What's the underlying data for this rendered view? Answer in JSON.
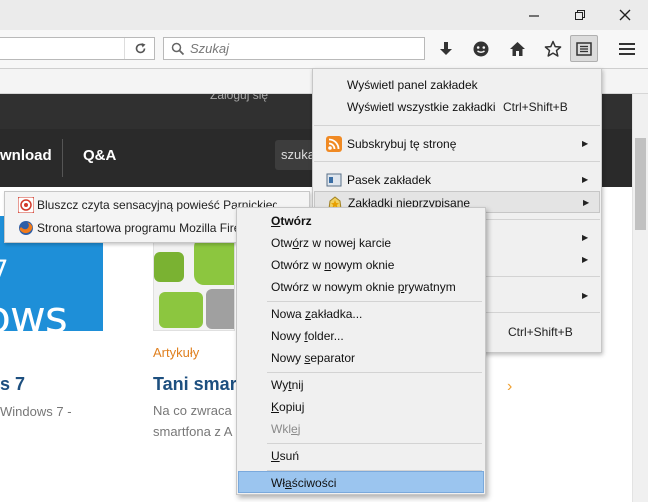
{
  "window": {
    "minimize_glyph": "—",
    "restore_glyph": "❐",
    "close_glyph": "✕"
  },
  "navbar": {
    "search_placeholder": "Szukaj",
    "icons": [
      "reload-icon",
      "search-icon",
      "downloads-icon",
      "pocket-icon",
      "home-icon",
      "bookmark-star-icon",
      "bookmarks-menu-icon",
      "hamburger-menu-icon"
    ]
  },
  "page": {
    "login": "Zaloguj się",
    "nav_download": "wnload",
    "nav_qa": "Q&A",
    "search_text": "szuka",
    "win_logo": "ows",
    "win_num": "7",
    "left_title": "s 7",
    "left_text": "Windows 7 -",
    "article_category": "Artykuły",
    "article_title": "Tani smar",
    "article_text_1": "Na co zwraca",
    "article_text_2": "smartfona z A",
    "arrow": "›"
  },
  "bookmarks_menu": {
    "items": [
      {
        "label": "Wyświetl panel zakładek",
        "shortcut": ""
      },
      {
        "label": "Wyświetl wszystkie zakładki",
        "shortcut": "Ctrl+Shift+B"
      },
      {
        "label": "Subskrybuj tę stronę",
        "shortcut": ""
      },
      {
        "label": "Pasek zakładek",
        "shortcut": ""
      },
      {
        "label": "Zakładki nieprzypisane",
        "shortcut": ""
      },
      {
        "label": "",
        "shortcut": "Ctrl+Shift+B"
      }
    ],
    "submenu_arrow": "▶"
  },
  "unsorted_bookmarks": [
    {
      "label": "Bluszcz czyta sensacyjną powieść Parnickiego"
    },
    {
      "label": "Strona startowa programu Mozilla Firefox"
    }
  ],
  "context_menu": {
    "items": [
      {
        "pre": "",
        "u": "O",
        "post": "twórz"
      },
      {
        "pre": "Otw",
        "u": "ó",
        "post": "rz w nowej karcie"
      },
      {
        "pre": "Otwórz w ",
        "u": "n",
        "post": "owym oknie"
      },
      {
        "pre": "Otwórz w nowym oknie ",
        "u": "p",
        "post": "rywatnym"
      },
      {
        "pre": "Nowa ",
        "u": "z",
        "post": "akładka..."
      },
      {
        "pre": "Nowy ",
        "u": "f",
        "post": "older..."
      },
      {
        "pre": "Nowy ",
        "u": "s",
        "post": "eparator"
      },
      {
        "pre": "Wy",
        "u": "t",
        "post": "nij"
      },
      {
        "pre": "",
        "u": "K",
        "post": "opiuj"
      },
      {
        "pre": "Wkl",
        "u": "e",
        "post": "j"
      },
      {
        "pre": "",
        "u": "U",
        "post": "suń"
      },
      {
        "pre": "Wł",
        "u": "a",
        "post": "ściwości"
      }
    ]
  }
}
